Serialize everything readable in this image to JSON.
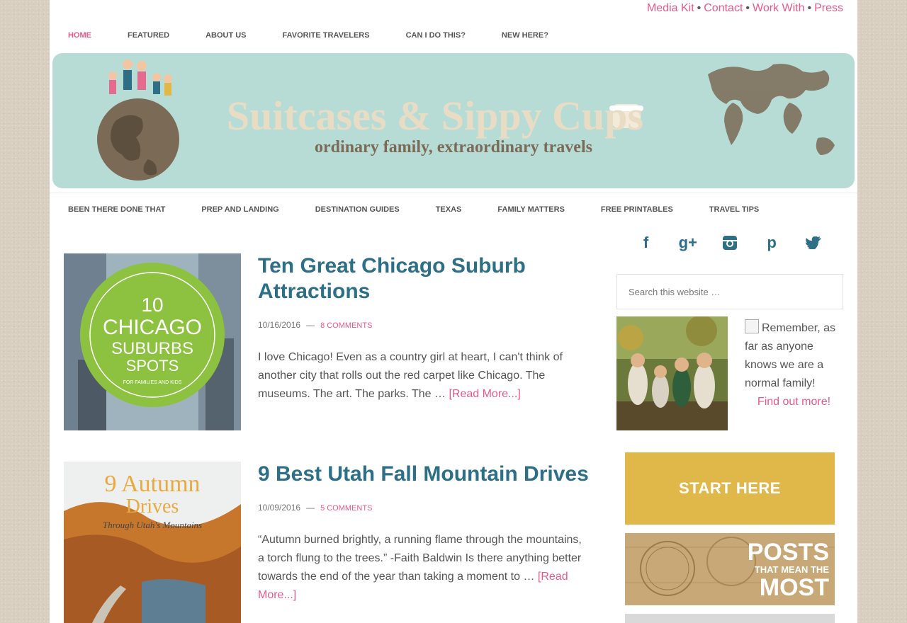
{
  "utility_links": [
    "Media Kit",
    "Contact",
    "Work With",
    "Press"
  ],
  "utility_separator": "•",
  "primary_nav": [
    "HOME",
    "FEATURED",
    "ABOUT US",
    "FAVORITE TRAVELERS",
    "CAN I DO THIS?",
    "NEW HERE?"
  ],
  "banner": {
    "title": "Suitcases & Sippy Cups",
    "tagline": "ordinary family, extraordinary travels"
  },
  "secondary_nav": [
    "BEEN THERE DONE THAT",
    "PREP AND LANDING",
    "DESTINATION GUIDES",
    "TEXAS",
    "FAMILY MATTERS",
    "FREE PRINTABLES",
    "TRAVEL TIPS"
  ],
  "posts": [
    {
      "title": "Ten Great Chicago Suburb Attractions",
      "date": "10/16/2016",
      "comments": "8 COMMENTS",
      "excerpt": "I love Chicago!  Even as a country girl at heart, I can't think of another city that rolls out the red carpet like Chicago.  The museums. The art. The parks. The …",
      "read_more": "[Read More...]",
      "thumb_text": {
        "line1": "10",
        "line2": "CHICAGO",
        "line3": "SUBURBS",
        "line4": "SPOTS",
        "line5": "FOR FAMILIES AND KIDS"
      }
    },
    {
      "title": "9 Best Utah Fall Mountain Drives",
      "date": "10/09/2016",
      "comments": "5 COMMENTS",
      "excerpt": "“Autumn burned brightly, a running flame through the mountains, a torch flung to the trees.” -Faith Baldwin Is there anything better towards the end of the year than taking a moment to …",
      "read_more": "[Read More...]",
      "thumb_text": {
        "line1": "9 Autumn",
        "line2": "Drives",
        "line3": "Through Utah's Mountains"
      }
    }
  ],
  "sidebar": {
    "social_icons": [
      "facebook-icon",
      "google-plus-icon",
      "instagram-icon",
      "pinterest-icon",
      "twitter-icon"
    ],
    "search_placeholder": "Search this website …",
    "about_text": "Remember, as far as anyone knows we are a normal family!",
    "about_link": "Find out more!",
    "start_here": "START HERE",
    "posts_promo": {
      "line1": "POSTS",
      "line2": "THAT MEAN THE",
      "line3": "MOST"
    }
  },
  "colors": {
    "accent_pink": "#e8598b",
    "title_teal": "#2c6f86",
    "banner_mint": "#b7dcd6",
    "start_gold": "#e0b84a"
  }
}
